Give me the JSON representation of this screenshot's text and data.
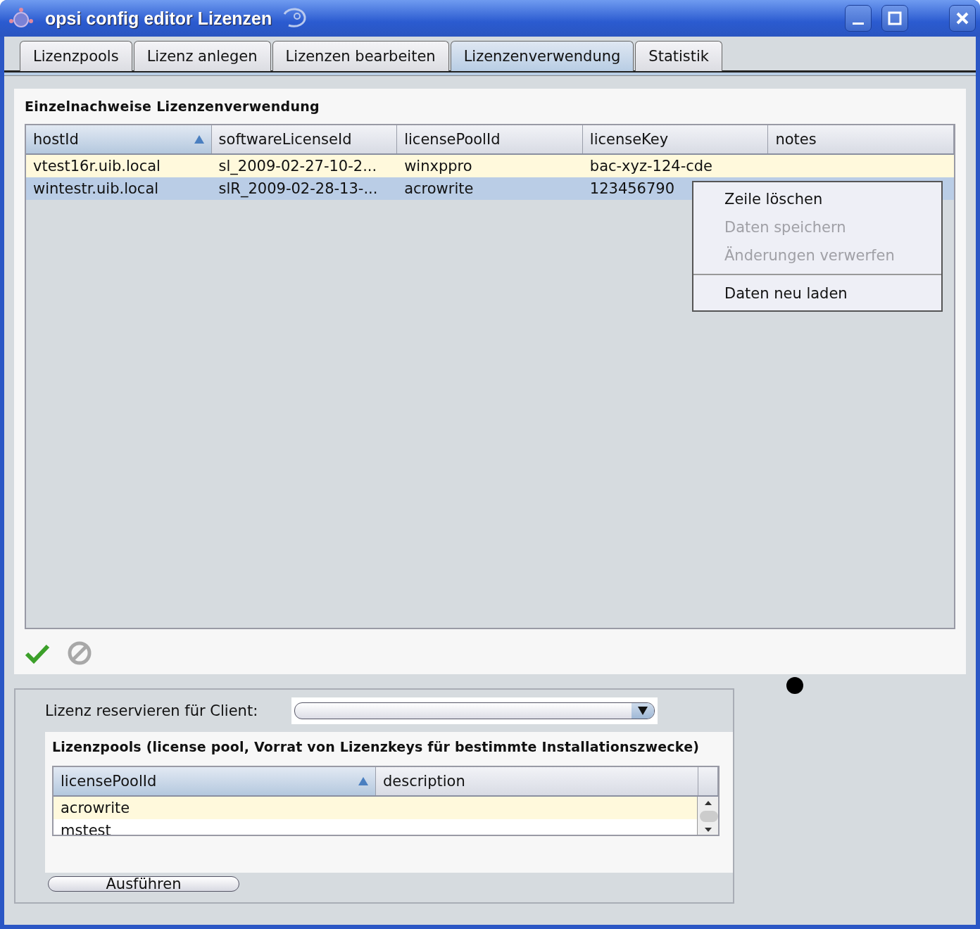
{
  "window": {
    "title": "opsi config editor Lizenzen"
  },
  "tabs": [
    {
      "label": "Lizenzpools",
      "selected": false
    },
    {
      "label": "Lizenz anlegen",
      "selected": false
    },
    {
      "label": "Lizenzen bearbeiten",
      "selected": false
    },
    {
      "label": "Lizenzenverwendung",
      "selected": true
    },
    {
      "label": "Statistik",
      "selected": false
    }
  ],
  "usage_panel": {
    "title": "Einzelnachweise Lizenzenverwendung",
    "table": {
      "columns": [
        {
          "label": "hostId",
          "sorted": true
        },
        {
          "label": "softwareLicenseId",
          "sorted": false
        },
        {
          "label": "licensePoolId",
          "sorted": false
        },
        {
          "label": "licenseKey",
          "sorted": false
        },
        {
          "label": "notes",
          "sorted": false
        }
      ],
      "rows": [
        {
          "cells": [
            "vtest16r.uib.local",
            "sl_2009-02-27-10-2...",
            "winxppro",
            "bac-xyz-124-cde",
            ""
          ],
          "selected": false
        },
        {
          "cells": [
            "wintestr.uib.local",
            "slR_2009-02-28-13-...",
            "acrowrite",
            "123456790",
            ""
          ],
          "selected": true
        }
      ]
    },
    "context_menu": [
      {
        "label": "Zeile löschen",
        "disabled": false,
        "separator_before": false
      },
      {
        "label": "Daten speichern",
        "disabled": true,
        "separator_before": false
      },
      {
        "label": "Änderungen verwerfen",
        "disabled": true,
        "separator_before": false
      },
      {
        "label": "Daten neu laden",
        "disabled": false,
        "separator_before": true
      }
    ],
    "actions": [
      {
        "kind": "save",
        "disabled": false
      },
      {
        "kind": "cancel",
        "disabled": true
      }
    ]
  },
  "reserve_panel": {
    "client_label": "Lizenz reservieren für Client:",
    "pools_title": "Lizenzpools (license pool, Vorrat von Lizenzkeys für bestimmte Installationszwecke)",
    "table": {
      "columns": [
        {
          "label": "licensePoolId",
          "sorted": true
        },
        {
          "label": "description",
          "sorted": false
        }
      ],
      "rows": [
        {
          "cells": [
            "acrowrite",
            ""
          ]
        },
        {
          "cells": [
            "mstest",
            ""
          ]
        }
      ]
    },
    "button": "Ausführen"
  }
}
